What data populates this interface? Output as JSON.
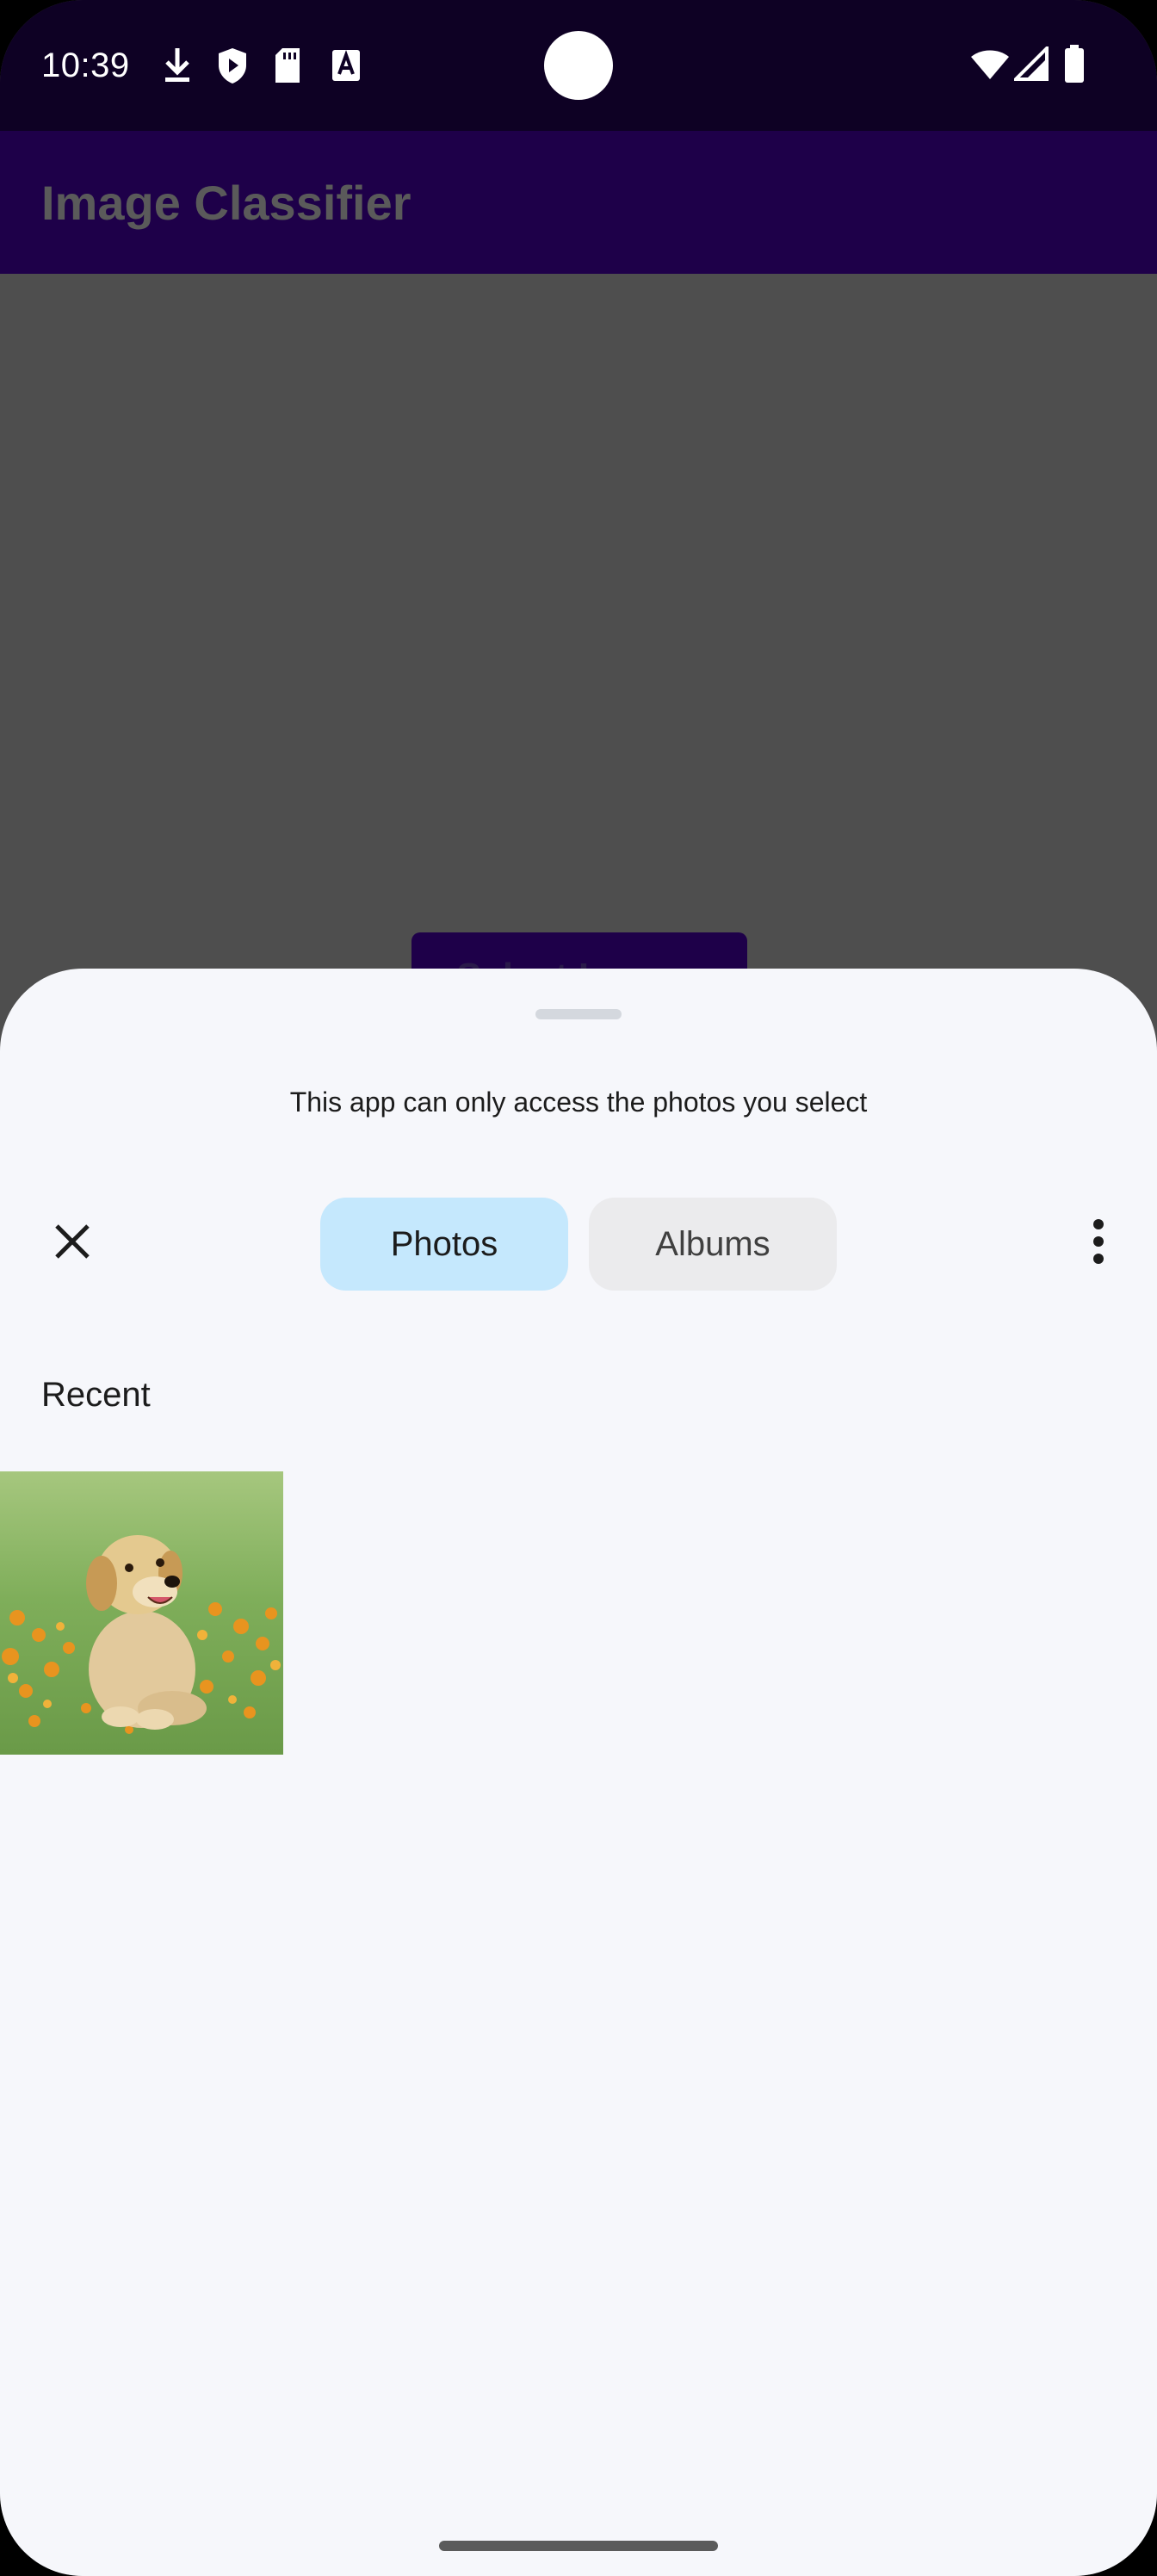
{
  "status_bar": {
    "time": "10:39",
    "left_icons": [
      "download-icon",
      "shield-play-icon",
      "sd-card-icon",
      "font-a-icon"
    ],
    "right_icons": [
      "wifi-icon",
      "signal-icon",
      "battery-icon"
    ]
  },
  "app": {
    "title": "Image Classifier",
    "select_button_label": "Select Image"
  },
  "picker": {
    "access_note": "This app can only access the photos you select",
    "close_icon": "close-icon",
    "tabs": [
      {
        "label": "Photos",
        "selected": true
      },
      {
        "label": "Albums",
        "selected": false
      }
    ],
    "more_icon": "more-vert-icon",
    "section_title": "Recent",
    "photos": [
      {
        "subject": "golden retriever puppy sitting in grass with orange flowers"
      }
    ]
  },
  "colors": {
    "status_bar": "#0e0124",
    "app_bar": "#1e0049",
    "scrim": "#4e4e4e",
    "sheet": "#f6f7fb",
    "tab_selected": "#c5e8fd",
    "tab_unselected": "#ebebed"
  }
}
